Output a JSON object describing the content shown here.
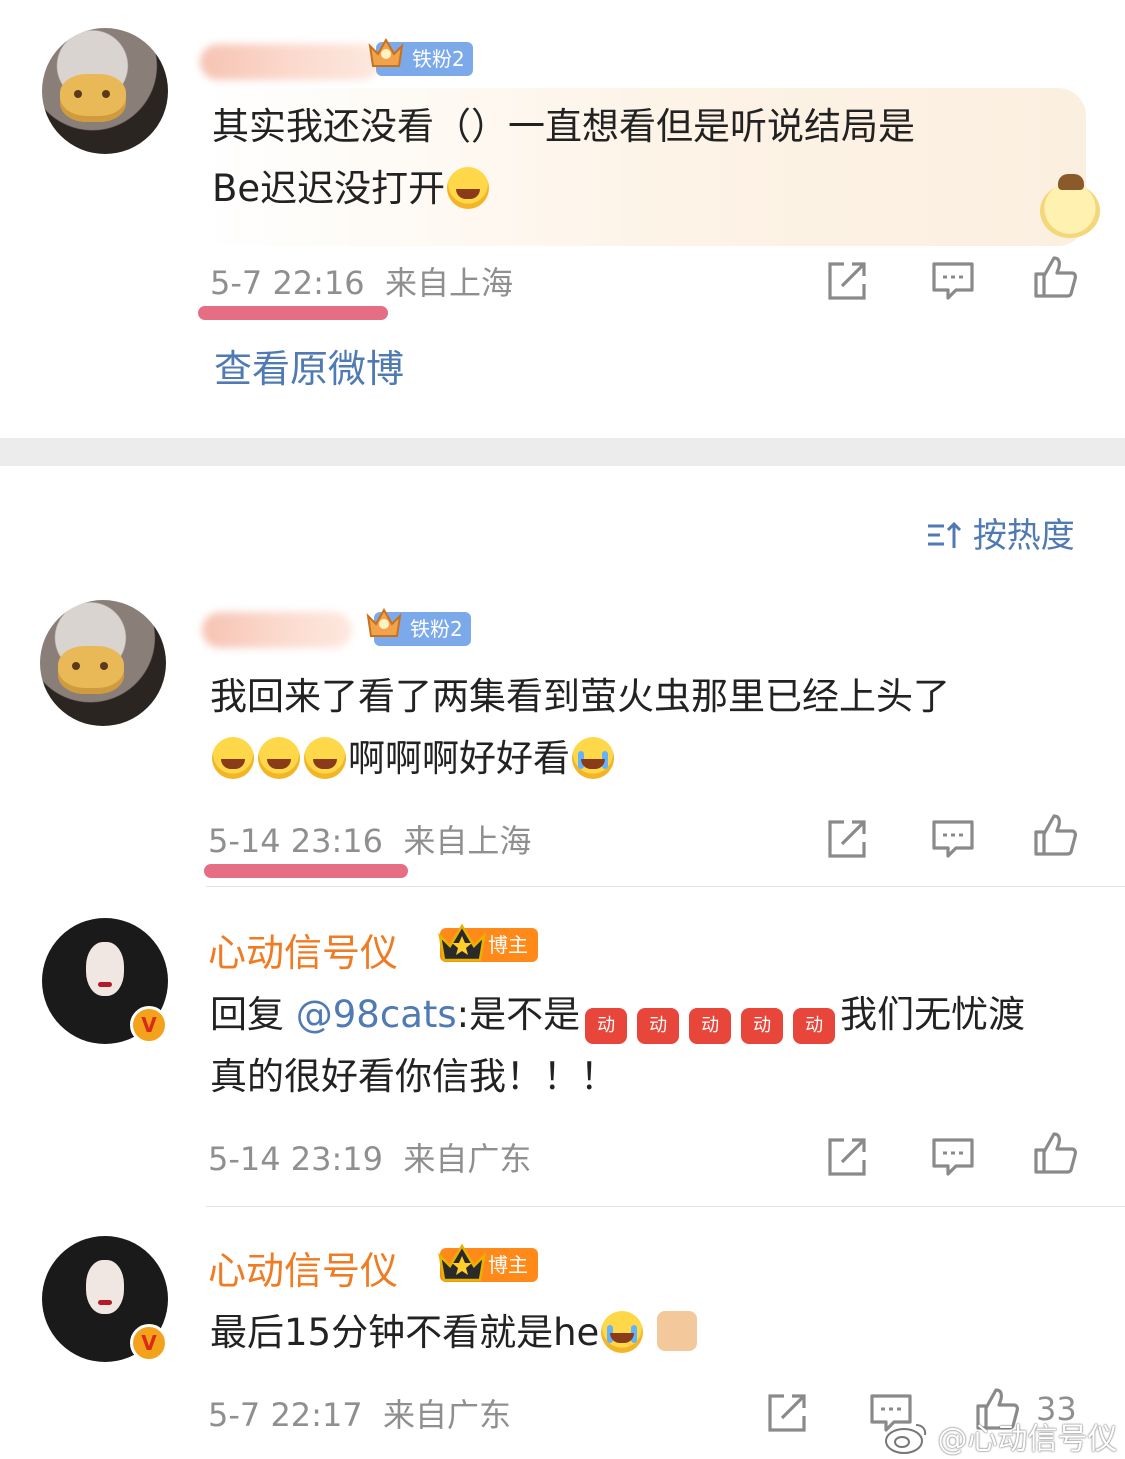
{
  "comments": [
    {
      "username_hidden": true,
      "fan_badge": "铁粉2",
      "text_lines": [
        "其实我还没看（）一直想看但是听说结局是",
        "Be迟迟没打开"
      ],
      "time": "5-7 22:16",
      "location": "来自上海",
      "view_original": "查看原微博"
    },
    {
      "username_hidden": true,
      "fan_badge": "铁粉2",
      "text_lines": [
        "我回来了看了两集看到萤火虫那里已经上头了",
        "啊啊啊好好看"
      ],
      "time": "5-14 23:16",
      "location": "来自上海"
    },
    {
      "username": "心动信号仪",
      "host_badge": "博主",
      "reply_prefix": "回复 ",
      "mention": "@98cats",
      "text_after_mention": ":是不是",
      "sticker_label": "动",
      "text_tail": "我们无忧渡",
      "text_line2": "真的很好看你信我！！！",
      "time": "5-14 23:19",
      "location": "来自广东"
    },
    {
      "username": "心动信号仪",
      "host_badge": "博主",
      "text": "最后15分钟不看就是he",
      "time": "5-7 22:17",
      "location": "来自广东",
      "like_count": "33"
    }
  ],
  "sort_label": "按热度",
  "verified_mark": "V",
  "watermark": "@心动信号仪",
  "colors": {
    "host_name": "#f07b22",
    "link": "#4f7ab3",
    "meta": "#8f8f8f",
    "underline": "#e66e84",
    "fan_badge": "#7ba9ea",
    "host_badge": "#ff8a1a"
  },
  "icons": [
    "share-icon",
    "comment-icon",
    "like-icon",
    "sort-icon",
    "crown-icon",
    "weibo-logo-icon"
  ]
}
